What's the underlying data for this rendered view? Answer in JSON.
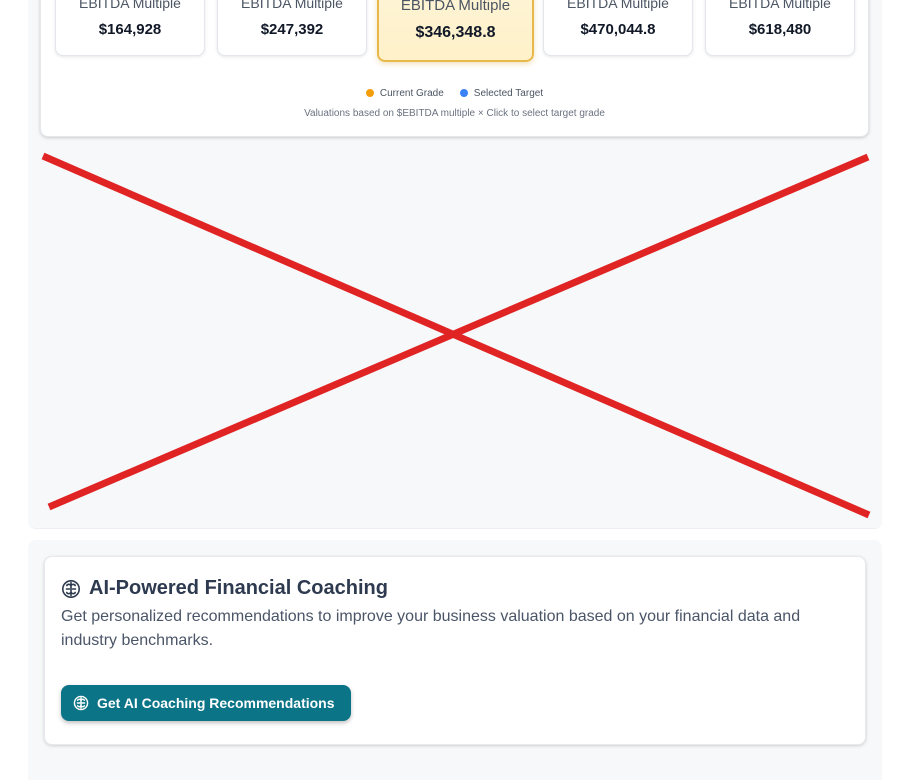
{
  "valuation": {
    "tiles": [
      {
        "label": "EBITDA Multiple",
        "value": "$164,928",
        "selected": false
      },
      {
        "label": "EBITDA Multiple",
        "value": "$247,392",
        "selected": false
      },
      {
        "label": "EBITDA Multiple",
        "value": "$346,348.8",
        "selected": true
      },
      {
        "label": "EBITDA Multiple",
        "value": "$470,044.8",
        "selected": false
      },
      {
        "label": "EBITDA Multiple",
        "value": "$618,480",
        "selected": false
      }
    ],
    "legend": {
      "current": {
        "label": "Current Grade",
        "color": "#f59e0b"
      },
      "selected": {
        "label": "Selected Target",
        "color": "#3b82f6"
      }
    },
    "footnote": "Valuations based on $EBITDA multiple × Click to select target grade"
  },
  "broken_graphic": {
    "color": "#e02424"
  },
  "coaching": {
    "icon": "brain-icon",
    "title": "AI-Powered Financial Coaching",
    "description": "Get personalized recommendations to improve your business valuation based on your financial data and industry benchmarks.",
    "button": {
      "label": "Get AI Coaching Recommendations",
      "icon": "brain-icon",
      "color": "#0b7487"
    }
  }
}
